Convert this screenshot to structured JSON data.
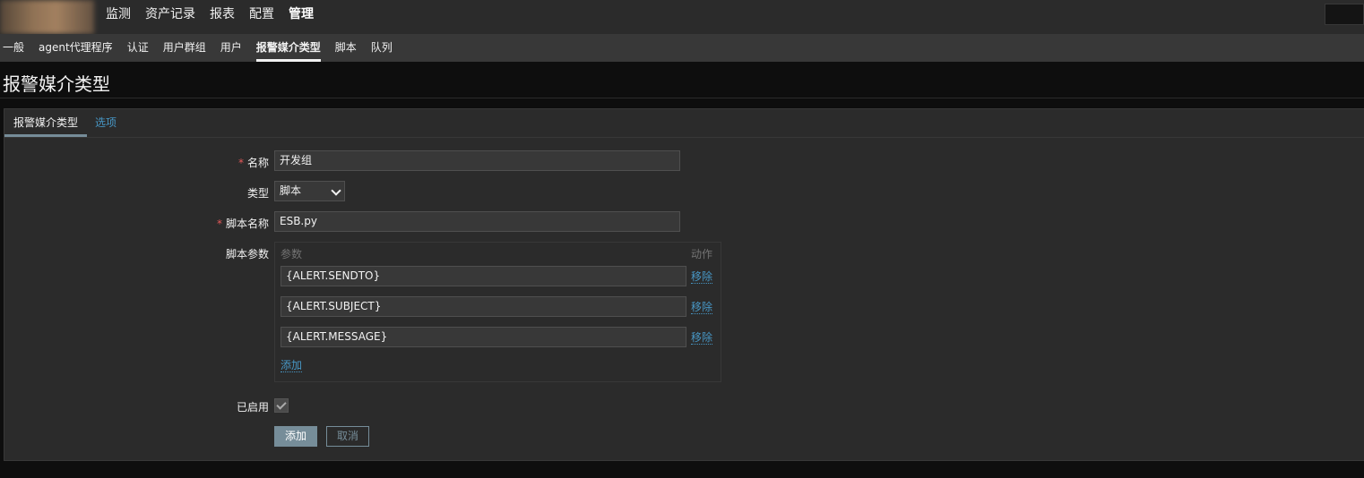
{
  "top_nav": {
    "items": [
      "监测",
      "资产记录",
      "报表",
      "配置",
      "管理"
    ],
    "active": "管理"
  },
  "sub_nav": {
    "items": [
      "一般",
      "agent代理程序",
      "认证",
      "用户群组",
      "用户",
      "报警媒介类型",
      "脚本",
      "队列"
    ],
    "active": "报警媒介类型"
  },
  "page_title": "报警媒介类型",
  "tabs": {
    "media_type": "报警媒介类型",
    "options": "选项"
  },
  "form": {
    "name_label": "名称",
    "name_value": "开发组",
    "type_label": "类型",
    "type_value": "脚本",
    "script_name_label": "脚本名称",
    "script_name_value": "ESB.py",
    "script_params_label": "脚本参数",
    "params_col_label": "参数",
    "action_col_label": "动作",
    "params": [
      {
        "value": "{ALERT.SENDTO}",
        "action": "移除"
      },
      {
        "value": "{ALERT.SUBJECT}",
        "action": "移除"
      },
      {
        "value": "{ALERT.MESSAGE}",
        "action": "移除"
      }
    ],
    "add_param_label": "添加",
    "enabled_label": "已启用",
    "enabled": true
  },
  "buttons": {
    "add": "添加",
    "cancel": "取消"
  },
  "colors": {
    "link": "#4796c4",
    "required": "#e45959",
    "primary_button": "#768d99"
  }
}
